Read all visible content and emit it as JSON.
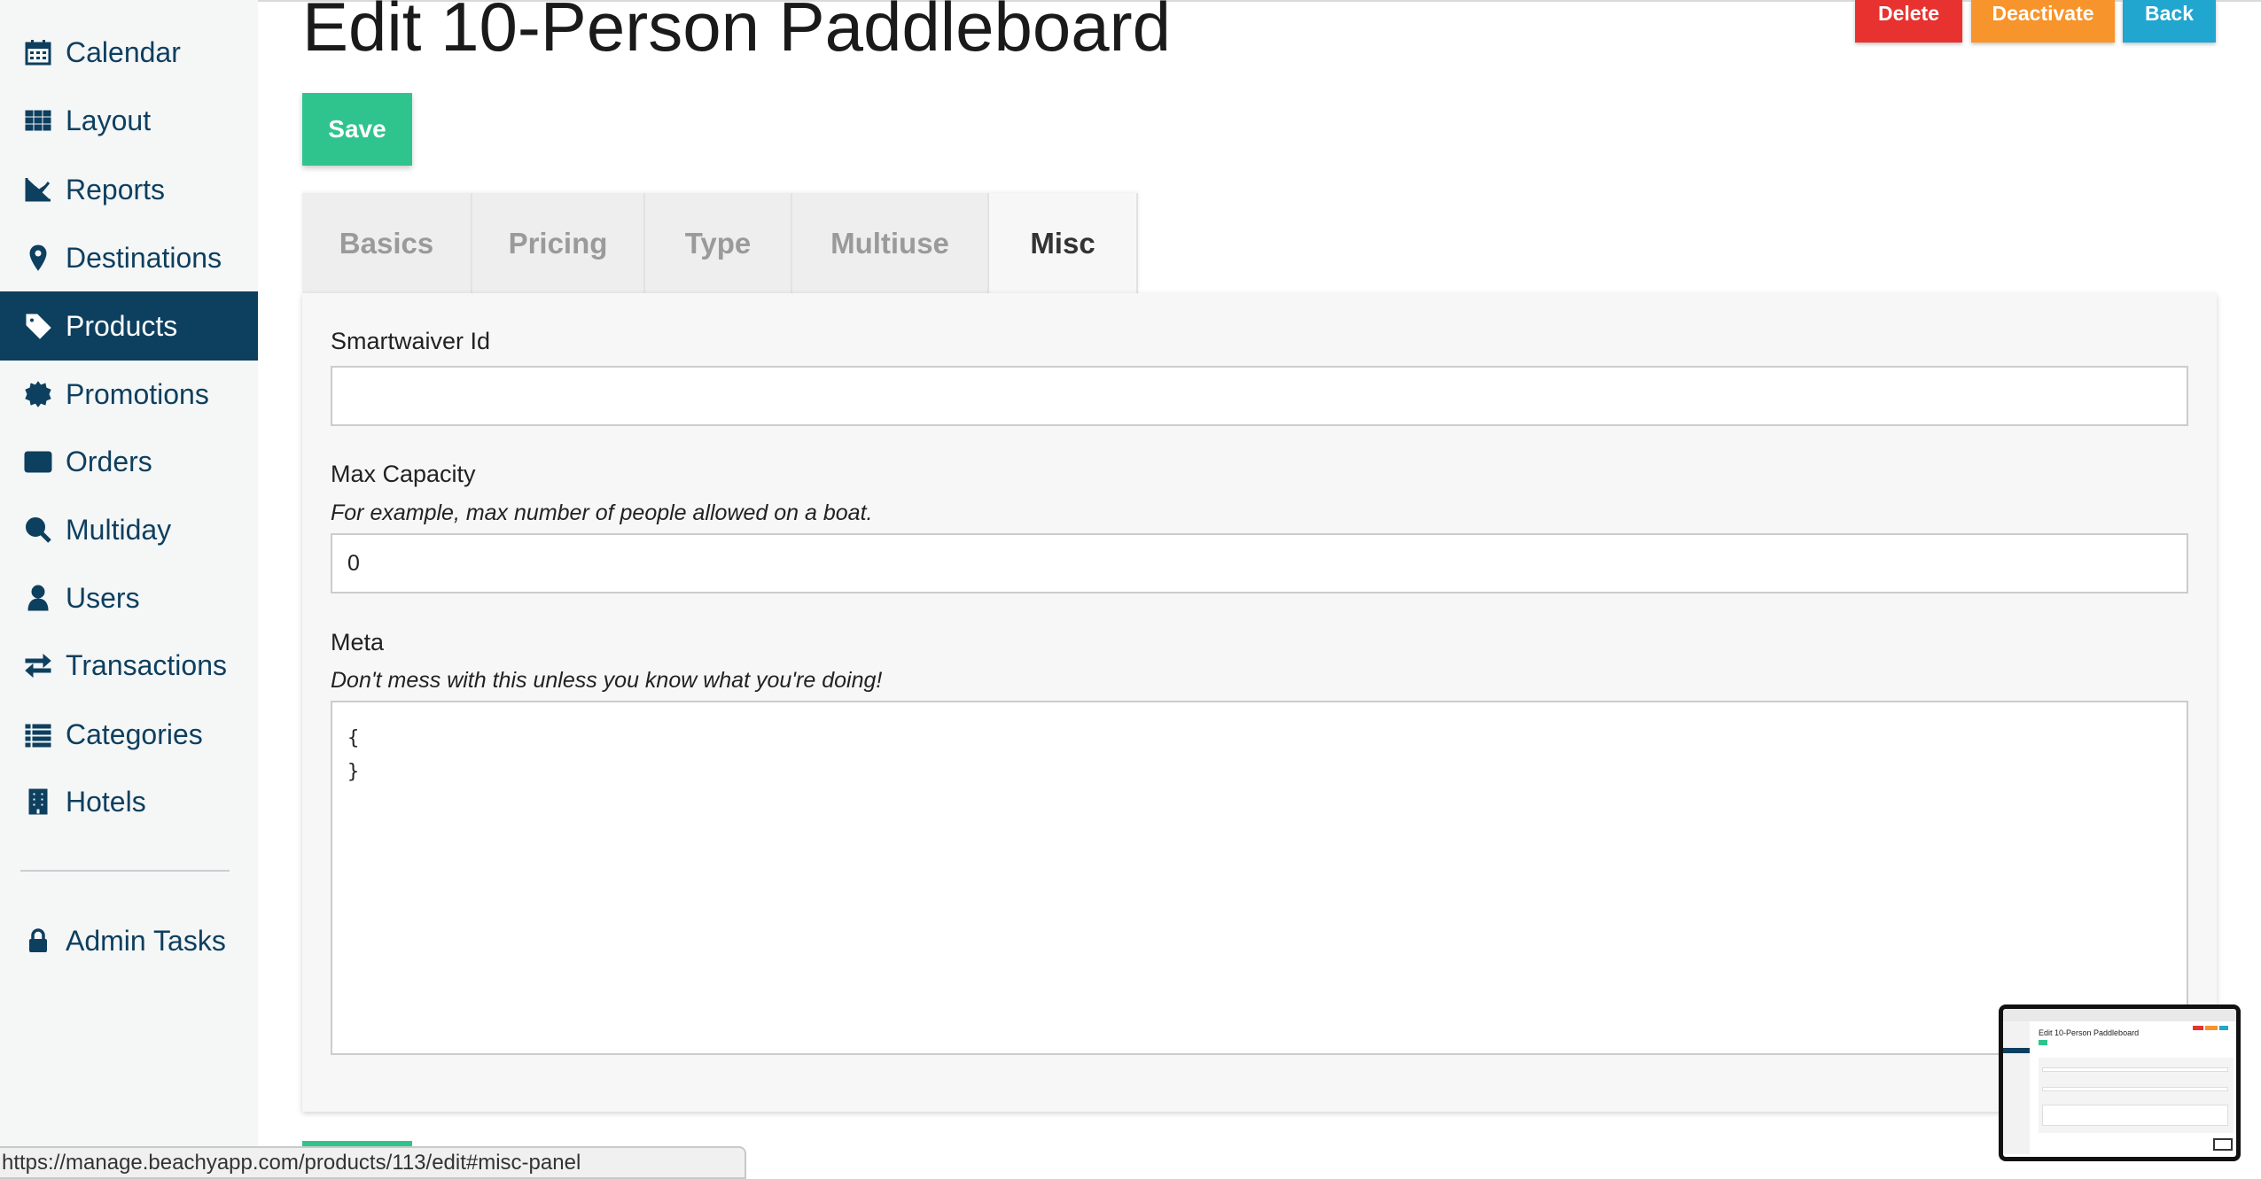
{
  "sidebar": {
    "items": [
      {
        "label": "Calendar",
        "icon": "calendar-icon"
      },
      {
        "label": "Layout",
        "icon": "grid-icon"
      },
      {
        "label": "Reports",
        "icon": "chart-line-icon"
      },
      {
        "label": "Destinations",
        "icon": "map-pin-icon"
      },
      {
        "label": "Products",
        "icon": "tag-icon",
        "active": true
      },
      {
        "label": "Promotions",
        "icon": "badge-icon"
      },
      {
        "label": "Orders",
        "icon": "credit-card-icon"
      },
      {
        "label": "Multiday",
        "icon": "search-icon"
      },
      {
        "label": "Users",
        "icon": "user-icon"
      },
      {
        "label": "Transactions",
        "icon": "exchange-icon"
      },
      {
        "label": "Categories",
        "icon": "list-icon"
      },
      {
        "label": "Hotels",
        "icon": "building-icon"
      }
    ],
    "admin": {
      "label": "Admin Tasks",
      "icon": "lock-icon"
    }
  },
  "header": {
    "title": "Edit 10-Person Paddleboard",
    "delete_label": "Delete",
    "deactivate_label": "Deactivate",
    "back_label": "Back",
    "save_label": "Save"
  },
  "tabs": [
    {
      "label": "Basics"
    },
    {
      "label": "Pricing"
    },
    {
      "label": "Type"
    },
    {
      "label": "Multiuse"
    },
    {
      "label": "Misc",
      "active": true
    }
  ],
  "form": {
    "smartwaiver": {
      "label": "Smartwaiver Id",
      "value": ""
    },
    "max_capacity": {
      "label": "Max Capacity",
      "help": "For example, max number of people allowed on a boat.",
      "value": "0"
    },
    "meta": {
      "label": "Meta",
      "help": "Don't mess with this unless you know what you're doing!",
      "value": "{\n}"
    }
  },
  "status_bar": {
    "url": "https://manage.beachyapp.com/products/113/edit#misc-panel"
  },
  "thumbnail": {
    "title": "Edit 10-Person Paddleboard"
  },
  "colors": {
    "sidebar_active": "#0d3f5f",
    "save": "#2fc48d",
    "delete": "#e8322f",
    "deactivate": "#f7942b",
    "back": "#20a6cf"
  }
}
